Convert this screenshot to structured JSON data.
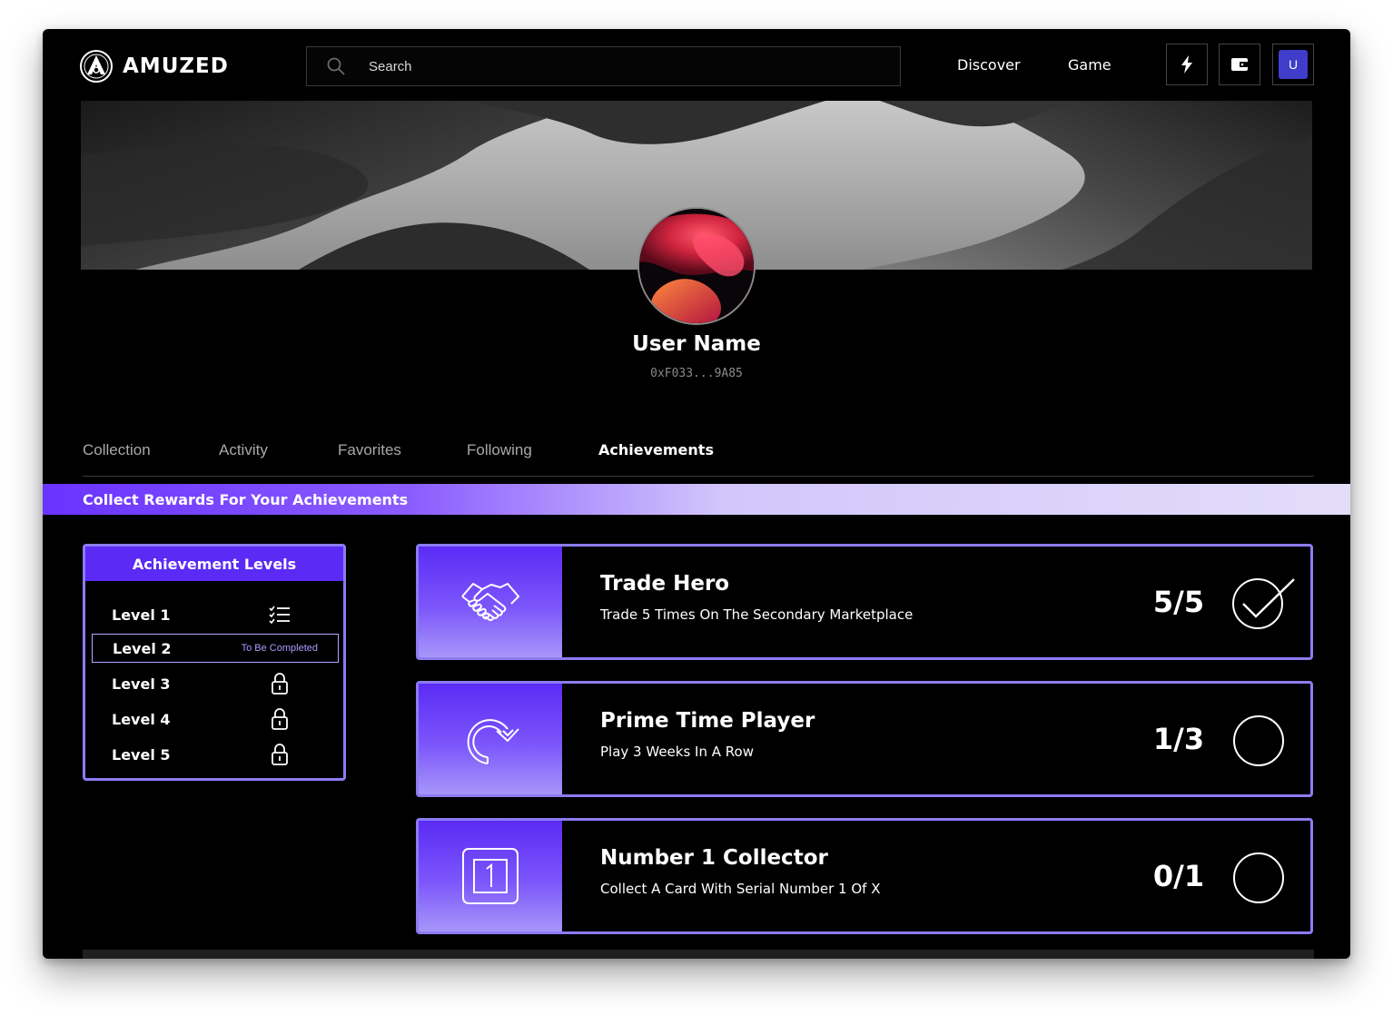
{
  "app": {
    "brand": "AMUZED"
  },
  "header": {
    "search_placeholder": "Search",
    "nav": [
      "Discover",
      "Game"
    ],
    "avatar_initial": "U"
  },
  "profile": {
    "name": "User Name",
    "wallet": "0xF033...9A85"
  },
  "tabs": [
    {
      "label": "Collection",
      "active": false
    },
    {
      "label": "Activity",
      "active": false
    },
    {
      "label": "Favorites",
      "active": false
    },
    {
      "label": "Following",
      "active": false
    },
    {
      "label": "Achievements",
      "active": true
    }
  ],
  "rewards_banner": "Collect Rewards For Your Achievements",
  "levels": {
    "title": "Achievement Levels",
    "items": [
      {
        "label": "Level 1",
        "icon": "checklist-icon",
        "status": ""
      },
      {
        "label": "Level 2",
        "icon": "",
        "status": "To Be Completed"
      },
      {
        "label": "Level 3",
        "icon": "lock-icon",
        "status": ""
      },
      {
        "label": "Level 4",
        "icon": "lock-icon",
        "status": ""
      },
      {
        "label": "Level 5",
        "icon": "lock-icon",
        "status": ""
      }
    ]
  },
  "achievements": [
    {
      "title": "Trade Hero",
      "description": "Trade 5 Times On The Secondary Marketplace",
      "count": "5/5",
      "icon": "handshake-icon",
      "completed": true
    },
    {
      "title": "Prime Time Player",
      "description": "Play 3 Weeks In A Row",
      "count": "1/3",
      "icon": "refresh-icon",
      "completed": false
    },
    {
      "title": "Number 1 Collector",
      "description": "Collect A Card With Serial Number 1 Of X",
      "count": "0/1",
      "icon": "number-one-card-icon",
      "completed": false
    }
  ],
  "colors": {
    "accent": "#5b2bf5",
    "border": "#8c7cf0",
    "background": "#000000"
  }
}
